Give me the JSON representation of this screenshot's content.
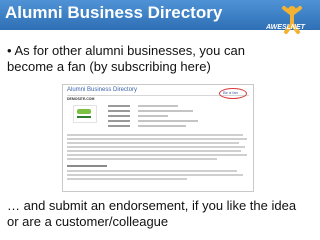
{
  "header": {
    "title": "Alumni Business Directory",
    "logo_text": "AWESLNET"
  },
  "bullet_text": "• As for other alumni businesses, you can become a fan (by subscribing here)",
  "screenshot": {
    "title": "Alumni Business Directory",
    "domain": "DEMOSITE.COM",
    "fan_label": "Be a fan"
  },
  "caption_text": "… and submit an endorsement, if you like the idea or are a customer/colleague"
}
